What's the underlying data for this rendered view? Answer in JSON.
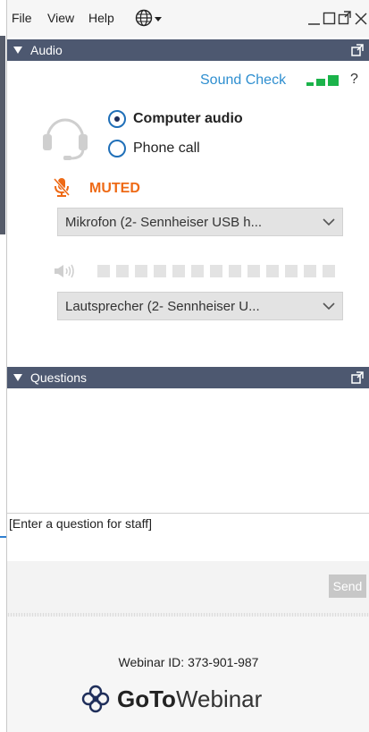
{
  "menu": {
    "file": "File",
    "view": "View",
    "help": "Help"
  },
  "window": {
    "minimize": "_"
  },
  "audio": {
    "header": "Audio",
    "sound_check": "Sound Check",
    "help_glyph": "?",
    "options": [
      {
        "label": "Computer audio",
        "selected": true
      },
      {
        "label": "Phone call",
        "selected": false
      }
    ],
    "mute_status": "MUTED",
    "microphone": "Mikrofon (2- Sennheiser USB h...",
    "speaker": "Lautsprecher (2- Sennheiser U...",
    "speaker_level": 0
  },
  "questions": {
    "header": "Questions",
    "input_placeholder": "[Enter a question for staff]",
    "send_label": "Send"
  },
  "footer": {
    "webinar_id": "Webinar ID: 373-901-987",
    "brand_bold": "GoTo",
    "brand_light": "Webinar"
  },
  "colors": {
    "header_bg": "#4d5870",
    "accent_blue": "#2f8fd0",
    "muted_orange": "#ee6a16",
    "signal_green": "#1bb34a"
  }
}
